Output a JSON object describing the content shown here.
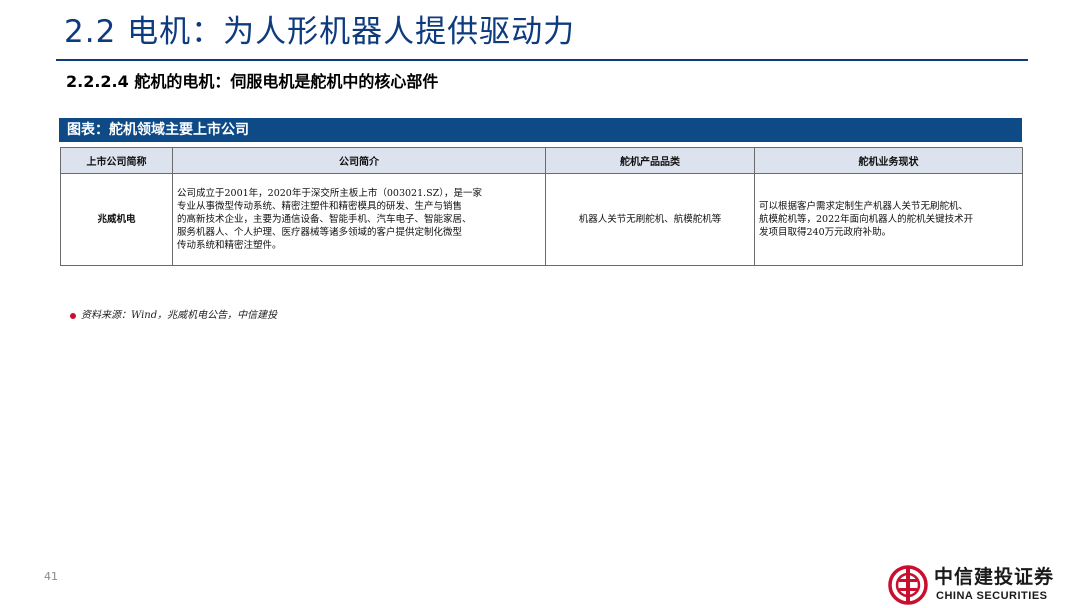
{
  "header": {
    "title": "2.2 电机：为人形机器人提供驱动力",
    "subtitle": "2.2.2.4 舵机的电机：伺服电机是舵机中的核心部件"
  },
  "figure": {
    "caption": "图表：舵机领域主要上市公司",
    "table": {
      "columns": [
        "上市公司简称",
        "公司简介",
        "舵机产品品类",
        "舵机业务现状"
      ],
      "rows": [
        {
          "company": "兆威机电",
          "intro_lines": [
            "公司成立于2001年，2020年于深交所主板上市（003021.SZ），是一家",
            "专业从事微型传动系统、精密注塑件和精密模具的研发、生产与销售",
            "的高新技术企业，主要为通信设备、智能手机、汽车电子、智能家居、",
            "服务机器人、个人护理、医疗器械等诸多领域的客户提供定制化微型",
            "传动系统和精密注塑件。"
          ],
          "products": "机器人关节无刷舵机、航模舵机等",
          "status_lines": [
            "可以根据客户需求定制生产机器人关节无刷舵机、",
            "航模舵机等，2022年面向机器人的舵机关键技术开",
            "发项目取得240万元政府补助。"
          ]
        }
      ]
    },
    "source": "资料来源：Wind，兆威机电公告，中信建投"
  },
  "footer": {
    "page_number": "41",
    "logo_cn": "中信建投证券",
    "logo_en": "CHINA SECURITIES"
  },
  "colors": {
    "brand_blue": "#0d3b7d",
    "caption_bar": "#0d4a86",
    "header_row": "#dde3ee",
    "logo_red": "#c8102e"
  }
}
